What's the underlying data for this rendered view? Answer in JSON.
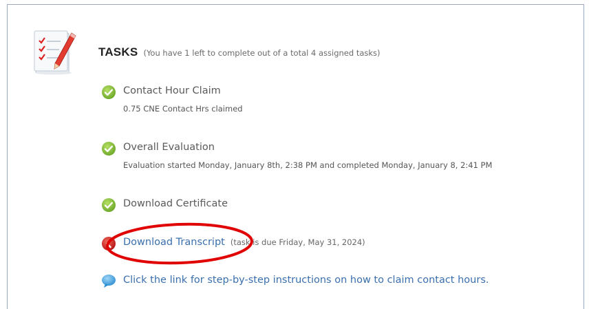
{
  "header": {
    "title": "TASKS",
    "summary": "(You have 1 left to complete out of a total 4 assigned tasks)"
  },
  "tasks": [
    {
      "label": "Contact Hour Claim",
      "status": "completed",
      "status_icon": "check-circle-icon",
      "detail": "0.75 CNE Contact Hrs claimed"
    },
    {
      "label": "Overall Evaluation",
      "status": "completed",
      "status_icon": "check-circle-icon",
      "detail": "Evaluation started Monday, January 8th, 2:38 PM and completed Monday, January 8, 2:41 PM"
    },
    {
      "label": "Download Certificate",
      "status": "completed",
      "status_icon": "check-circle-icon"
    },
    {
      "label": "Download Transcript",
      "status": "incomplete",
      "status_icon": "chevron-left-circle-icon",
      "due": "(task is due Friday, May 31, 2024)"
    }
  ],
  "help": {
    "icon": "speech-bubble-icon",
    "text": "Click the link for step-by-step instructions on how to claim contact hours."
  },
  "colors": {
    "link": "#3a6fae",
    "check": "#8cc23f",
    "incomplete": "#d42a2a",
    "annotation": "#e00000",
    "help_icon": "#4aa6e0"
  }
}
